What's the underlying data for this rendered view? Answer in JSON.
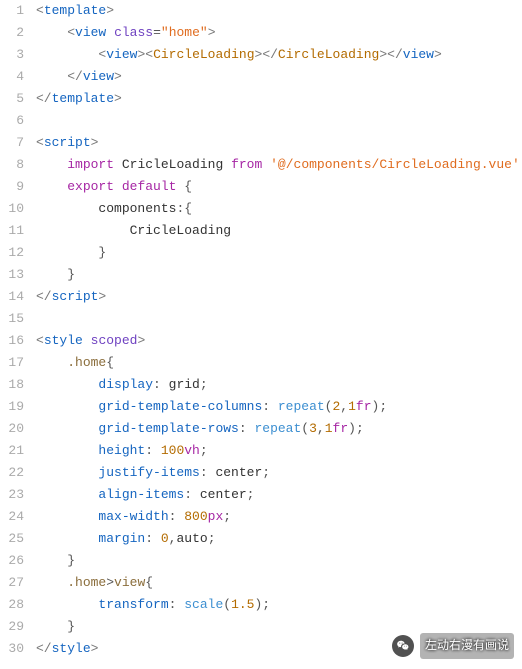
{
  "lines": [
    {
      "n": "1",
      "segs": [
        {
          "c": "tag-angle",
          "t": "<"
        },
        {
          "c": "tag-name",
          "t": "template"
        },
        {
          "c": "tag-angle",
          "t": ">"
        }
      ]
    },
    {
      "n": "2",
      "segs": [
        {
          "c": "",
          "t": "    "
        },
        {
          "c": "tag-angle",
          "t": "<"
        },
        {
          "c": "tag-name",
          "t": "view"
        },
        {
          "c": "",
          "t": " "
        },
        {
          "c": "attr-name",
          "t": "class"
        },
        {
          "c": "punct",
          "t": "="
        },
        {
          "c": "attr-val",
          "t": "\"home\""
        },
        {
          "c": "tag-angle",
          "t": ">"
        }
      ]
    },
    {
      "n": "3",
      "segs": [
        {
          "c": "",
          "t": "        "
        },
        {
          "c": "tag-angle",
          "t": "<"
        },
        {
          "c": "tag-name",
          "t": "view"
        },
        {
          "c": "tag-angle",
          "t": ">"
        },
        {
          "c": "tag-angle",
          "t": "<"
        },
        {
          "c": "component",
          "t": "CircleLoading"
        },
        {
          "c": "tag-angle",
          "t": ">"
        },
        {
          "c": "tag-angle",
          "t": "</"
        },
        {
          "c": "component",
          "t": "CircleLoading"
        },
        {
          "c": "tag-angle",
          "t": ">"
        },
        {
          "c": "tag-angle",
          "t": "</"
        },
        {
          "c": "tag-name",
          "t": "view"
        },
        {
          "c": "tag-angle",
          "t": ">"
        }
      ]
    },
    {
      "n": "4",
      "segs": [
        {
          "c": "",
          "t": "    "
        },
        {
          "c": "tag-angle",
          "t": "</"
        },
        {
          "c": "tag-name",
          "t": "view"
        },
        {
          "c": "tag-angle",
          "t": ">"
        }
      ]
    },
    {
      "n": "5",
      "segs": [
        {
          "c": "tag-angle",
          "t": "</"
        },
        {
          "c": "tag-name",
          "t": "template"
        },
        {
          "c": "tag-angle",
          "t": ">"
        }
      ]
    },
    {
      "n": "6",
      "segs": [
        {
          "c": "",
          "t": ""
        }
      ]
    },
    {
      "n": "7",
      "segs": [
        {
          "c": "tag-angle",
          "t": "<"
        },
        {
          "c": "tag-name",
          "t": "script"
        },
        {
          "c": "tag-angle",
          "t": ">"
        }
      ]
    },
    {
      "n": "8",
      "segs": [
        {
          "c": "",
          "t": "    "
        },
        {
          "c": "keyword",
          "t": "import"
        },
        {
          "c": "",
          "t": " "
        },
        {
          "c": "ident",
          "t": "CricleLoading"
        },
        {
          "c": "",
          "t": " "
        },
        {
          "c": "keyword",
          "t": "from"
        },
        {
          "c": "",
          "t": " "
        },
        {
          "c": "string",
          "t": "'@/components/CircleLoading.vue'"
        }
      ]
    },
    {
      "n": "9",
      "segs": [
        {
          "c": "",
          "t": "    "
        },
        {
          "c": "keyword",
          "t": "export"
        },
        {
          "c": "",
          "t": " "
        },
        {
          "c": "keyword",
          "t": "default"
        },
        {
          "c": "",
          "t": " "
        },
        {
          "c": "brace",
          "t": "{"
        }
      ]
    },
    {
      "n": "10",
      "segs": [
        {
          "c": "",
          "t": "        "
        },
        {
          "c": "ident",
          "t": "components"
        },
        {
          "c": "punct",
          "t": ":"
        },
        {
          "c": "brace",
          "t": "{"
        }
      ]
    },
    {
      "n": "11",
      "segs": [
        {
          "c": "",
          "t": "            "
        },
        {
          "c": "ident",
          "t": "CricleLoading"
        }
      ]
    },
    {
      "n": "12",
      "segs": [
        {
          "c": "",
          "t": "        "
        },
        {
          "c": "brace",
          "t": "}"
        }
      ]
    },
    {
      "n": "13",
      "segs": [
        {
          "c": "",
          "t": "    "
        },
        {
          "c": "brace",
          "t": "}"
        }
      ]
    },
    {
      "n": "14",
      "segs": [
        {
          "c": "tag-angle",
          "t": "</"
        },
        {
          "c": "tag-name",
          "t": "script"
        },
        {
          "c": "tag-angle",
          "t": ">"
        }
      ]
    },
    {
      "n": "15",
      "segs": [
        {
          "c": "",
          "t": ""
        }
      ]
    },
    {
      "n": "16",
      "segs": [
        {
          "c": "tag-angle",
          "t": "<"
        },
        {
          "c": "tag-name",
          "t": "style"
        },
        {
          "c": "",
          "t": " "
        },
        {
          "c": "attr-name",
          "t": "scoped"
        },
        {
          "c": "tag-angle",
          "t": ">"
        }
      ]
    },
    {
      "n": "17",
      "segs": [
        {
          "c": "",
          "t": "    "
        },
        {
          "c": "css-sel",
          "t": ".home"
        },
        {
          "c": "brace",
          "t": "{"
        }
      ]
    },
    {
      "n": "18",
      "segs": [
        {
          "c": "",
          "t": "        "
        },
        {
          "c": "css-prop",
          "t": "display"
        },
        {
          "c": "punct",
          "t": ": "
        },
        {
          "c": "css-val",
          "t": "grid"
        },
        {
          "c": "punct",
          "t": ";"
        }
      ]
    },
    {
      "n": "19",
      "segs": [
        {
          "c": "",
          "t": "        "
        },
        {
          "c": "css-prop",
          "t": "grid-template-columns"
        },
        {
          "c": "punct",
          "t": ": "
        },
        {
          "c": "css-func",
          "t": "repeat"
        },
        {
          "c": "punct",
          "t": "("
        },
        {
          "c": "css-num",
          "t": "2"
        },
        {
          "c": "punct",
          "t": ","
        },
        {
          "c": "css-num",
          "t": "1"
        },
        {
          "c": "css-unit",
          "t": "fr"
        },
        {
          "c": "punct",
          "t": ")"
        },
        {
          "c": "punct",
          "t": ";"
        }
      ]
    },
    {
      "n": "20",
      "segs": [
        {
          "c": "",
          "t": "        "
        },
        {
          "c": "css-prop",
          "t": "grid-template-rows"
        },
        {
          "c": "punct",
          "t": ": "
        },
        {
          "c": "css-func",
          "t": "repeat"
        },
        {
          "c": "punct",
          "t": "("
        },
        {
          "c": "css-num",
          "t": "3"
        },
        {
          "c": "punct",
          "t": ","
        },
        {
          "c": "css-num",
          "t": "1"
        },
        {
          "c": "css-unit",
          "t": "fr"
        },
        {
          "c": "punct",
          "t": ")"
        },
        {
          "c": "punct",
          "t": ";"
        }
      ]
    },
    {
      "n": "21",
      "segs": [
        {
          "c": "",
          "t": "        "
        },
        {
          "c": "css-prop",
          "t": "height"
        },
        {
          "c": "punct",
          "t": ": "
        },
        {
          "c": "css-num",
          "t": "100"
        },
        {
          "c": "css-unit",
          "t": "vh"
        },
        {
          "c": "punct",
          "t": ";"
        }
      ]
    },
    {
      "n": "22",
      "segs": [
        {
          "c": "",
          "t": "        "
        },
        {
          "c": "css-prop",
          "t": "justify-items"
        },
        {
          "c": "punct",
          "t": ": "
        },
        {
          "c": "css-val",
          "t": "center"
        },
        {
          "c": "punct",
          "t": ";"
        }
      ]
    },
    {
      "n": "23",
      "segs": [
        {
          "c": "",
          "t": "        "
        },
        {
          "c": "css-prop",
          "t": "align-items"
        },
        {
          "c": "punct",
          "t": ": "
        },
        {
          "c": "css-val",
          "t": "center"
        },
        {
          "c": "punct",
          "t": ";"
        }
      ]
    },
    {
      "n": "24",
      "segs": [
        {
          "c": "",
          "t": "        "
        },
        {
          "c": "css-prop",
          "t": "max-width"
        },
        {
          "c": "punct",
          "t": ": "
        },
        {
          "c": "css-num",
          "t": "800"
        },
        {
          "c": "css-unit",
          "t": "px"
        },
        {
          "c": "punct",
          "t": ";"
        }
      ]
    },
    {
      "n": "25",
      "segs": [
        {
          "c": "",
          "t": "        "
        },
        {
          "c": "css-prop",
          "t": "margin"
        },
        {
          "c": "punct",
          "t": ": "
        },
        {
          "c": "css-num",
          "t": "0"
        },
        {
          "c": "punct",
          "t": ","
        },
        {
          "c": "css-val",
          "t": "auto"
        },
        {
          "c": "punct",
          "t": ";"
        }
      ]
    },
    {
      "n": "26",
      "segs": [
        {
          "c": "",
          "t": "    "
        },
        {
          "c": "brace",
          "t": "}"
        }
      ]
    },
    {
      "n": "27",
      "segs": [
        {
          "c": "",
          "t": "    "
        },
        {
          "c": "css-sel",
          "t": ".home"
        },
        {
          "c": "punct",
          "t": ">"
        },
        {
          "c": "css-sel",
          "t": "view"
        },
        {
          "c": "brace",
          "t": "{"
        }
      ]
    },
    {
      "n": "28",
      "segs": [
        {
          "c": "",
          "t": "        "
        },
        {
          "c": "css-prop",
          "t": "transform"
        },
        {
          "c": "punct",
          "t": ": "
        },
        {
          "c": "css-func",
          "t": "scale"
        },
        {
          "c": "punct",
          "t": "("
        },
        {
          "c": "css-num",
          "t": "1.5"
        },
        {
          "c": "punct",
          "t": ")"
        },
        {
          "c": "punct",
          "t": ";"
        }
      ]
    },
    {
      "n": "29",
      "segs": [
        {
          "c": "",
          "t": "    "
        },
        {
          "c": "brace",
          "t": "}"
        }
      ]
    },
    {
      "n": "30",
      "segs": [
        {
          "c": "tag-angle",
          "t": "</"
        },
        {
          "c": "tag-name",
          "t": "style"
        },
        {
          "c": "tag-angle",
          "t": ">"
        }
      ]
    }
  ],
  "watermark": {
    "text": "左动右漫有画说"
  }
}
